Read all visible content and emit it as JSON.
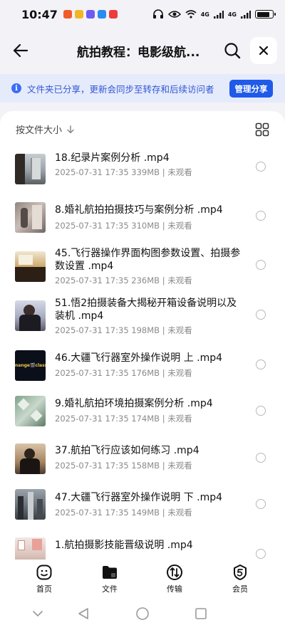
{
  "status_bar": {
    "time": "10:47",
    "signal_1": "4G",
    "signal_2": "4G",
    "battery_level": 0.85
  },
  "header": {
    "title": "航拍教程：电影级航..."
  },
  "banner": {
    "text": "文件夹已分享，更新会同步至转存和后续访问者",
    "button_label": "管理分享"
  },
  "sort": {
    "label": "按文件大小"
  },
  "files": [
    {
      "name": "18.纪录片案例分析 .mp4",
      "meta": "2025-07-31 17:35  339MB | 未观看"
    },
    {
      "name": "8.婚礼航拍拍摄技巧与案例分析 .mp4",
      "meta": "2025-07-31 17:35  310MB | 未观看"
    },
    {
      "name": "45.飞行器操作界面构图参数设置、拍摄参数设置 .mp4",
      "meta": "2025-07-31 17:35  236MB | 未观看"
    },
    {
      "name": "51.悟2拍摄装备大揭秘开箱设备说明以及装机 .mp4",
      "meta": "2025-07-31 17:35  198MB | 未观看"
    },
    {
      "name": "46.大疆飞行器室外操作说明 上 .mp4",
      "meta": "2025-07-31 17:35  176MB | 未观看"
    },
    {
      "name": "9.婚礼航拍环境拍摄案例分析 .mp4",
      "meta": "2025-07-31 17:35  174MB | 未观看"
    },
    {
      "name": "37.航拍飞行应该如何练习 .mp4",
      "meta": "2025-07-31 17:35  158MB | 未观看"
    },
    {
      "name": "47.大疆飞行器室外操作说明 下 .mp4",
      "meta": "2025-07-31 17:35  149MB | 未观看"
    },
    {
      "name": "1.航拍摄影技能晋级说明 .mp4",
      "meta": ""
    }
  ],
  "thumb_overlay_text": "nange🎬class",
  "bottom_nav": [
    {
      "label": "首页",
      "icon": "home-icon"
    },
    {
      "label": "文件",
      "icon": "folder-icon"
    },
    {
      "label": "传输",
      "icon": "transfer-icon"
    },
    {
      "label": "会员",
      "icon": "vip-icon"
    }
  ],
  "colors": {
    "accent": "#1f5ae8",
    "banner_bg": "#e6ebfb",
    "banner_text": "#3057d5"
  }
}
